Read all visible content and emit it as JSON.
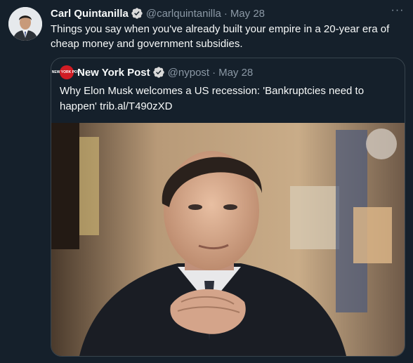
{
  "tweet": {
    "author_name": "Carl Quintanilla",
    "author_handle": "@carlquintanilla",
    "separator": "·",
    "time": "May 28",
    "more_label": "···",
    "text": "Things you say when you've already built your empire in a 20-year era of cheap money and government subsidies."
  },
  "quote": {
    "author_name": "New York Post",
    "author_handle": "@nypost",
    "separator": "·",
    "time": "May 28",
    "avatar_logo": "NEW YORK POST",
    "text": "Why Elon Musk welcomes a US recession: 'Bankruptcies need to happen' trib.al/T490zXD"
  },
  "colors": {
    "background": "#15202b",
    "verified": "#1d9bf0",
    "secondary_text": "#8b98a5",
    "nypost_red": "#d01c24"
  }
}
